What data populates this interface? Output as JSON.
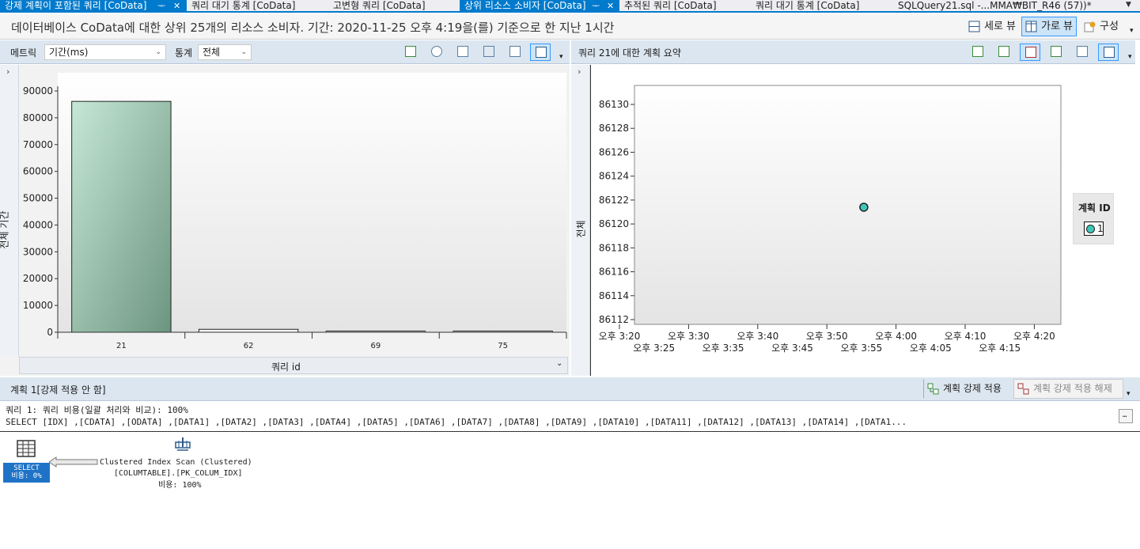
{
  "tabs": [
    {
      "label": "강제 계획이 포함된 쿼리 [CoData]",
      "active": true,
      "pin": "ᅮ",
      "close": "✕"
    },
    {
      "label": "쿼리 대기 통계 [CoData]",
      "active": false
    },
    {
      "label": "고변형 쿼리 [CoData]",
      "active": false
    },
    {
      "label": "상위 리소스 소비자 [CoData]",
      "active": true,
      "pin": "ᅮ",
      "close": "✕"
    },
    {
      "label": "추적된 쿼리 [CoData]",
      "active": false
    },
    {
      "label": "쿼리 대기 통계 [CoData]",
      "active": false
    },
    {
      "label": "SQLQuery21.sql -...MMA₩BIT_R46 (57))*",
      "active": false
    }
  ],
  "title": "데이터베이스 CoData에 대한 상위 25개의 리소스 소비자. 기간: 2020-11-25 오후 4:19을(를) 기준으로 한 지난 1시간",
  "view_buttons": {
    "vertical": "세로 뷰",
    "horizontal": "가로 뷰",
    "configure": "구성"
  },
  "left_pane": {
    "metric_label": "메트릭",
    "metric_value": "기간(ms)",
    "stat_label": "통계",
    "stat_value": "전체",
    "y_axis_label": "전체 기간",
    "x_axis_label": "쿼리 id"
  },
  "right_pane": {
    "title": "쿼리 21에 대한 계획 요약",
    "y_axis_label": "전체",
    "legend_title": "계획 ID",
    "legend_item": "1"
  },
  "plan_bar": {
    "label": "계획 1[강제 적용 안 함]",
    "force_button": "계획 강제 적용",
    "unforce_button": "계획 강제 적용 해제"
  },
  "sql": {
    "line1": "쿼리 1: 쿼리 비용(일괄 처리와 비교): 100%",
    "line2": "SELECT [IDX] ,[CDATA] ,[ODATA] ,[DATA1] ,[DATA2] ,[DATA3] ,[DATA4] ,[DATA5] ,[DATA6] ,[DATA7] ,[DATA8] ,[DATA9] ,[DATA10] ,[DATA11] ,[DATA12] ,[DATA13] ,[DATA14] ,[DATA1..."
  },
  "plan": {
    "select_label": "SELECT",
    "select_cost": "비용: 0%",
    "scan_label": "Clustered Index Scan (Clustered)",
    "scan_object": "[COLUMTABLE].[PK_COLUM_IDX]",
    "scan_cost": "비용: 100%"
  },
  "chart_data": [
    {
      "type": "bar",
      "categories": [
        "21",
        "62",
        "69",
        "75"
      ],
      "values": [
        86120,
        1100,
        150,
        120
      ],
      "xlabel": "쿼리 id",
      "ylabel": "전체 기간",
      "ylim": [
        0,
        90000
      ],
      "yticks": [
        0,
        10000,
        20000,
        30000,
        40000,
        50000,
        60000,
        70000,
        80000,
        90000
      ],
      "grid": false
    },
    {
      "type": "scatter",
      "x": [
        "오후 3:55"
      ],
      "series": [
        {
          "name": "1",
          "values": [
            86121.4
          ]
        }
      ],
      "ylabel": "전체",
      "ylim": [
        86112,
        86130
      ],
      "yticks": [
        86112,
        86114,
        86116,
        86118,
        86120,
        86122,
        86124,
        86126,
        86128,
        86130
      ],
      "xticks_top": [
        "오후 3:20",
        "오후 3:30",
        "오후 3:40",
        "오후 3:50",
        "오후 4:00",
        "오후 4:10",
        "오후 4:20"
      ],
      "xticks_bottom": [
        "오후 3:25",
        "오후 3:35",
        "오후 3:45",
        "오후 3:55",
        "오후 4:05",
        "오후 4:15"
      ],
      "legend_title": "계획 ID",
      "legend": "right",
      "grid": false
    }
  ]
}
